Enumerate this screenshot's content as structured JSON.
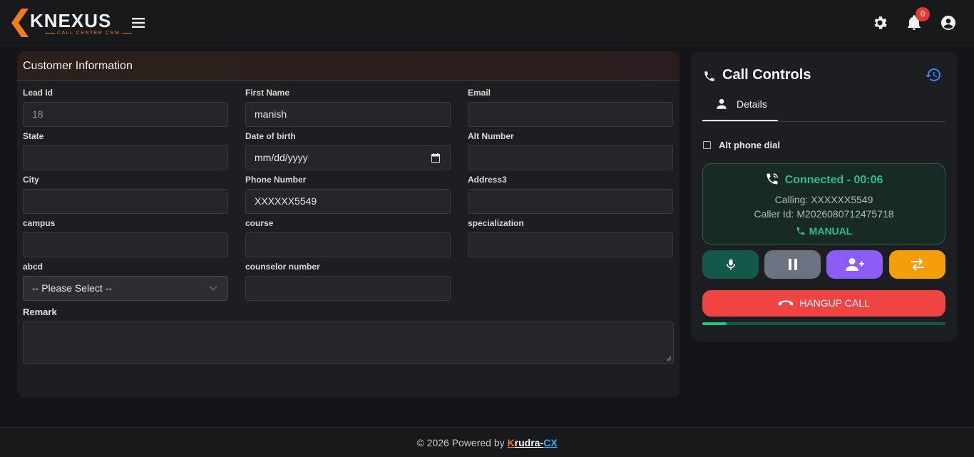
{
  "header": {
    "logo_text": "KNEXUS",
    "logo_sub": "CALL CENTER CRM",
    "notification_count": "0",
    "icons": [
      "menu-icon",
      "gear-icon",
      "bell-icon",
      "user-circle-icon"
    ]
  },
  "customer": {
    "title": "Customer Information",
    "fields": {
      "lead_id": {
        "label": "Lead Id",
        "value": "18"
      },
      "first_name": {
        "label": "First Name",
        "value": "manish"
      },
      "email": {
        "label": "Email",
        "value": ""
      },
      "state": {
        "label": "State",
        "value": ""
      },
      "dob": {
        "label": "Date of birth",
        "value": "mm/dd/yyyy"
      },
      "alt_number": {
        "label": "Alt Number",
        "value": ""
      },
      "city": {
        "label": "City",
        "value": ""
      },
      "phone": {
        "label": "Phone Number",
        "value": "XXXXXX5549"
      },
      "address3": {
        "label": "Address3",
        "value": ""
      },
      "campus": {
        "label": "campus",
        "value": ""
      },
      "course": {
        "label": "course",
        "value": ""
      },
      "specialization": {
        "label": "specialization",
        "value": ""
      },
      "abcd": {
        "label": "abcd",
        "value": "-- Please Select --"
      },
      "counselor_number": {
        "label": "counselor number",
        "value": ""
      }
    },
    "remark_label": "Remark"
  },
  "call_controls": {
    "title": "Call Controls",
    "tab_details": "Details",
    "alt_phone_label": "Alt phone dial",
    "status": "Connected - 00:06",
    "calling": "Calling: XXXXXX5549",
    "caller_id": "Caller Id: M2026080712475718",
    "mode": "MANUAL",
    "hangup_label": "HANGUP CALL",
    "progress_fraction": 0.1,
    "colors": {
      "mute": "#13584a",
      "hold": "#6b7280",
      "add_user": "#8b5cf6",
      "transfer": "#f59e0b",
      "hangup": "#ef4444",
      "connected": "#2ebd86"
    }
  },
  "footer": {
    "prefix": "© 2026 Powered by ",
    "brand_k": "K",
    "brand_rest": "rudra-",
    "brand_cx": "CX"
  }
}
